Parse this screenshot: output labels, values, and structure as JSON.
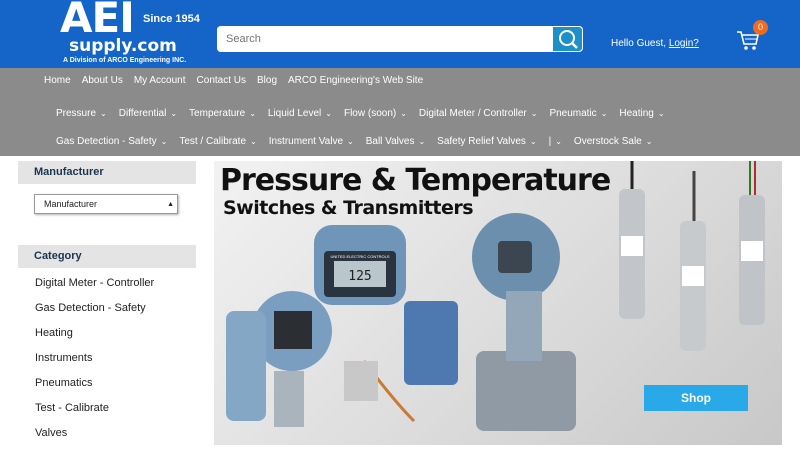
{
  "logo": {
    "main": "AEI",
    "since": "Since 1954",
    "supply": "supply.com",
    "division": "A Division of ARCO Engineering INC."
  },
  "search": {
    "placeholder": "Search"
  },
  "account": {
    "greeting": "Hello Guest,",
    "login": "Login?"
  },
  "cart": {
    "count": "0"
  },
  "toplinks": [
    "Home",
    "About Us",
    "My Account",
    "Contact Us",
    "Blog",
    "ARCO Engineering's Web Site"
  ],
  "menu_row1": [
    "Pressure",
    "Differential",
    "Temperature",
    "Liquid Level",
    "Flow (soon)",
    "Digital Meter / Controller",
    "Pneumatic",
    "Heating"
  ],
  "menu_row2": [
    "Gas Detection - Safety",
    "Test / Calibrate",
    "Instrument Valve",
    "Ball Valves",
    "Safety Relief Valves",
    "|",
    "Overstock Sale"
  ],
  "sidebar": {
    "manufacturer_title": "Manufacturer",
    "manufacturer_selected": "Manufacturer",
    "category_title": "Category",
    "categories": [
      "Digital Meter - Controller",
      "Gas Detection - Safety",
      "Heating",
      "Instruments",
      "Pneumatics",
      "Test - Calibrate",
      "Valves"
    ]
  },
  "banner": {
    "title": "Pressure & Temperature",
    "subtitle": "Switches & Transmitters",
    "shop_label": "Shop",
    "gauge_brand": "UNITED ELECTRIC CONTROLS",
    "gauge_reading": "125"
  },
  "colors": {
    "header_bg": "#1565c9",
    "nav_bg": "#8b8b8b",
    "badge": "#f26a1b",
    "shop": "#2aa9e8"
  }
}
